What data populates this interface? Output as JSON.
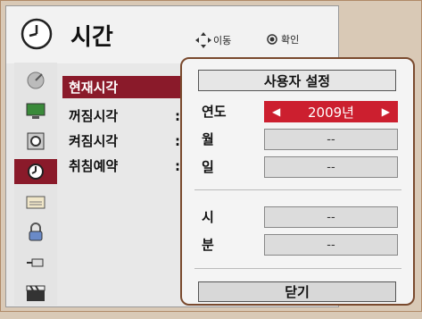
{
  "header": {
    "title": "시간",
    "nav_hint": "이동",
    "ok_hint": "확인",
    "clock_icon": "clock-icon",
    "nav_icon": "dpad-icon",
    "ok_icon": "ok-button-icon"
  },
  "sidebar": {
    "icons": [
      "satellite-dish-icon",
      "monitor-icon",
      "speaker-icon",
      "clock-icon",
      "keyboard-icon",
      "lock-icon",
      "usb-icon",
      "clapperboard-icon"
    ],
    "active_index": 3
  },
  "menu": {
    "items": [
      {
        "label": "현재시각",
        "colon": ""
      },
      {
        "label": "꺼짐시각",
        "colon": ":"
      },
      {
        "label": "켜짐시각",
        "colon": ":"
      },
      {
        "label": "취침예약",
        "colon": ":"
      }
    ],
    "active_index": 0
  },
  "dialog": {
    "title": "사용자 설정",
    "fields": [
      {
        "label": "연도",
        "value": "2009년"
      },
      {
        "label": "월",
        "value": "--"
      },
      {
        "label": "일",
        "value": "--"
      },
      {
        "label": "시",
        "value": "--"
      },
      {
        "label": "분",
        "value": "--"
      }
    ],
    "selected_index": 0,
    "close_label": "닫기"
  },
  "colors": {
    "accent": "#cc1f2f",
    "menu_active": "#8a1a2a",
    "dialog_border": "#7a4a2e"
  }
}
